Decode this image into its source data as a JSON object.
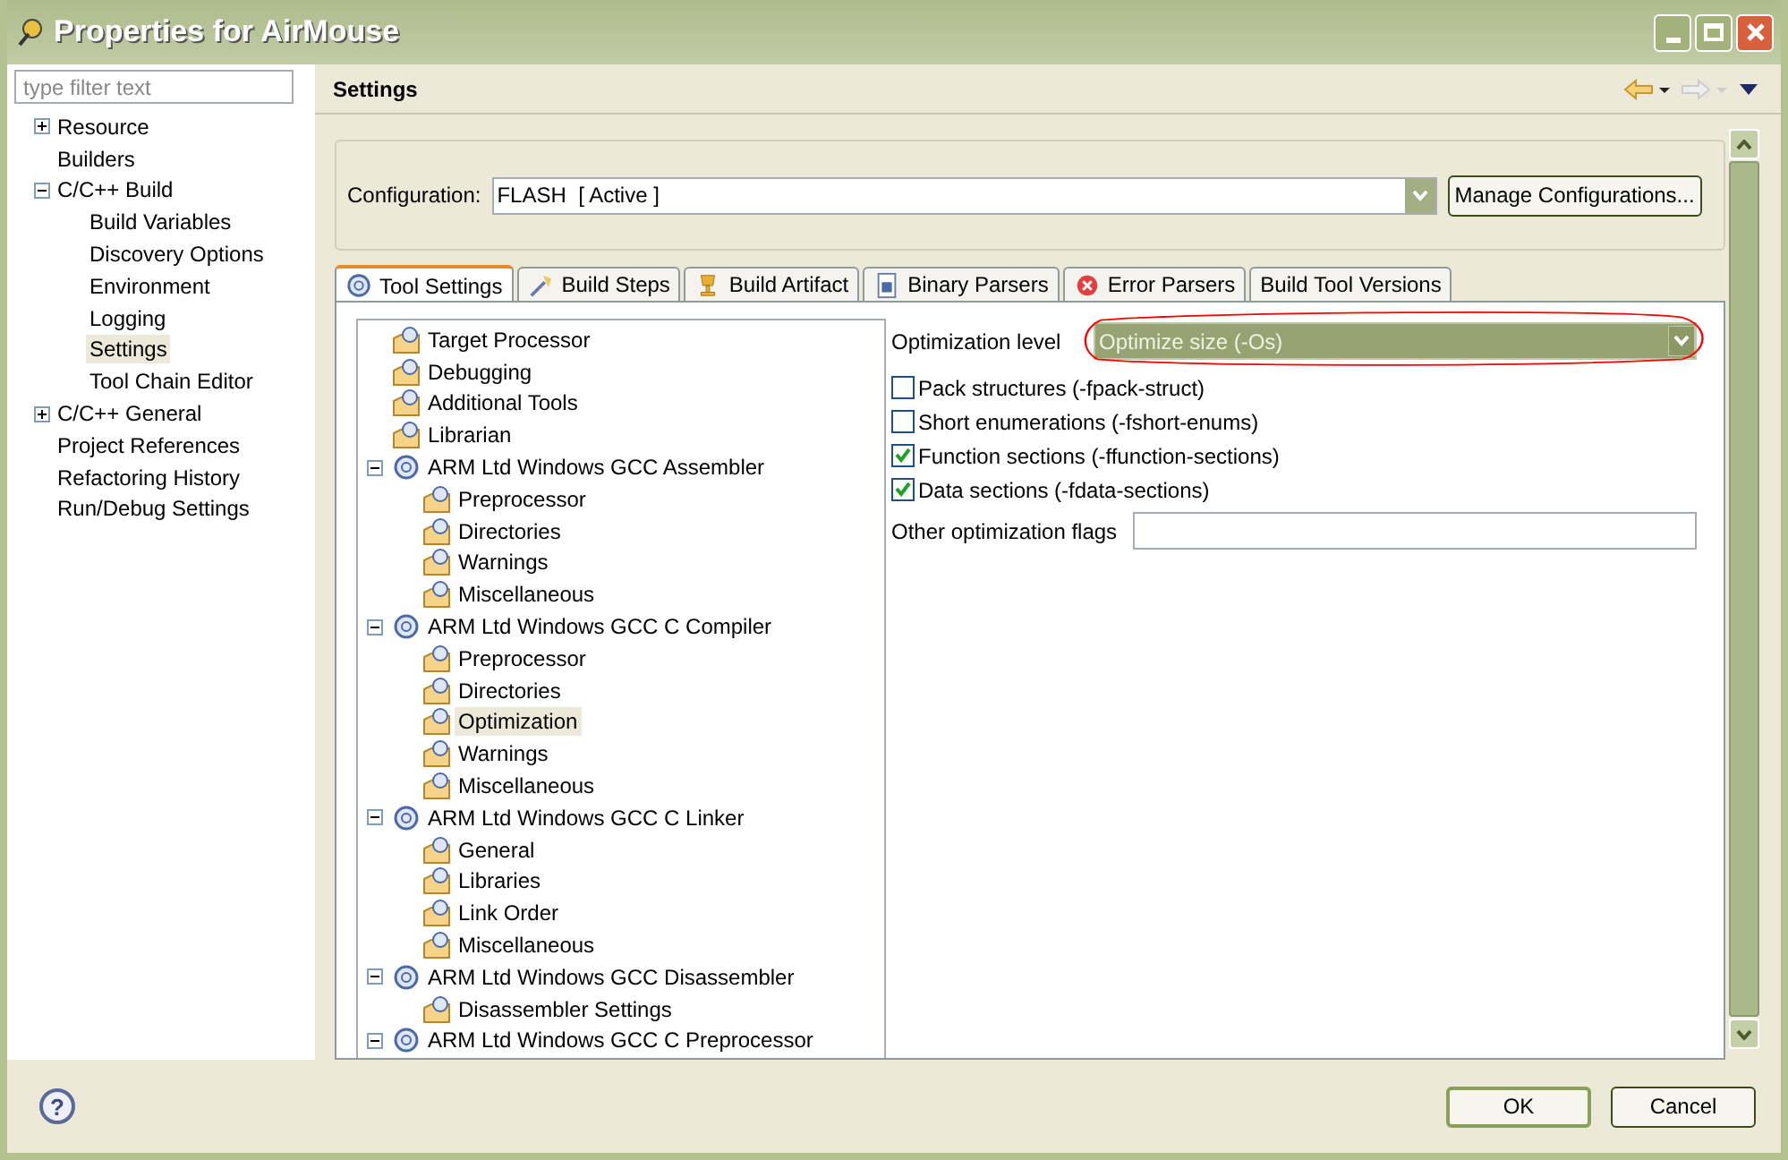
{
  "window": {
    "title": "Properties for AirMouse"
  },
  "filter": {
    "placeholder": "type filter text"
  },
  "sidebar": {
    "items": [
      {
        "label": "Resource",
        "expanded": false,
        "selected": false
      },
      {
        "label": "Builders",
        "selected": false
      },
      {
        "label": "C/C++ Build",
        "expanded": true,
        "selected": false,
        "children": [
          {
            "label": "Build Variables",
            "selected": false
          },
          {
            "label": "Discovery Options",
            "selected": false
          },
          {
            "label": "Environment",
            "selected": false
          },
          {
            "label": "Logging",
            "selected": false
          },
          {
            "label": "Settings",
            "selected": true
          },
          {
            "label": "Tool Chain Editor",
            "selected": false
          }
        ]
      },
      {
        "label": "C/C++ General",
        "expanded": false,
        "selected": false
      },
      {
        "label": "Project References",
        "selected": false
      },
      {
        "label": "Refactoring History",
        "selected": false
      },
      {
        "label": "Run/Debug Settings",
        "selected": false
      }
    ]
  },
  "page": {
    "title": "Settings"
  },
  "configuration": {
    "label": "Configuration:",
    "value": "FLASH  [ Active ]",
    "button": "Manage Configurations..."
  },
  "tabs": [
    {
      "label": "Tool Settings",
      "selected": true
    },
    {
      "label": "Build Steps",
      "selected": false
    },
    {
      "label": "Build Artifact",
      "selected": false
    },
    {
      "label": "Binary Parsers",
      "selected": false
    },
    {
      "label": "Error Parsers",
      "selected": false
    },
    {
      "label": "Build Tool Versions",
      "selected": false
    }
  ],
  "tool_tree": [
    {
      "label": "Target Processor",
      "selected": false
    },
    {
      "label": "Debugging",
      "selected": false
    },
    {
      "label": "Additional Tools",
      "selected": false
    },
    {
      "label": "Librarian",
      "selected": false
    },
    {
      "label": "ARM Ltd Windows GCC Assembler",
      "expanded": true,
      "selected": false,
      "children": [
        {
          "label": "Preprocessor",
          "selected": false
        },
        {
          "label": "Directories",
          "selected": false
        },
        {
          "label": "Warnings",
          "selected": false
        },
        {
          "label": "Miscellaneous",
          "selected": false
        }
      ]
    },
    {
      "label": "ARM Ltd Windows GCC C Compiler",
      "expanded": true,
      "selected": false,
      "children": [
        {
          "label": "Preprocessor",
          "selected": false
        },
        {
          "label": "Directories",
          "selected": false
        },
        {
          "label": "Optimization",
          "selected": true
        },
        {
          "label": "Warnings",
          "selected": false
        },
        {
          "label": "Miscellaneous",
          "selected": false
        }
      ]
    },
    {
      "label": "ARM Ltd Windows GCC C Linker",
      "expanded": true,
      "selected": false,
      "children": [
        {
          "label": "General",
          "selected": false
        },
        {
          "label": "Libraries",
          "selected": false
        },
        {
          "label": "Link Order",
          "selected": false
        },
        {
          "label": "Miscellaneous",
          "selected": false
        }
      ]
    },
    {
      "label": "ARM Ltd Windows GCC Disassembler",
      "expanded": true,
      "selected": false,
      "children": [
        {
          "label": "Disassembler Settings",
          "selected": false
        }
      ]
    },
    {
      "label": "ARM Ltd Windows GCC C Preprocessor",
      "expanded": true,
      "selected": false
    }
  ],
  "optimization": {
    "label": "Optimization level",
    "value": "Optimize size (-Os)",
    "highlight": {
      "kind": "ellipse",
      "color": "#ff0000"
    }
  },
  "options": [
    {
      "label": "Pack structures (-fpack-struct)",
      "checked": false
    },
    {
      "label": "Short enumerations (-fshort-enums)",
      "checked": false
    },
    {
      "label": "Function sections (-ffunction-sections)",
      "checked": true
    },
    {
      "label": "Data sections (-fdata-sections)",
      "checked": true
    }
  ],
  "other_flags": {
    "label": "Other optimization flags"
  },
  "help_button": {
    "label": "?"
  },
  "buttons": [
    "OK",
    "Cancel"
  ]
}
